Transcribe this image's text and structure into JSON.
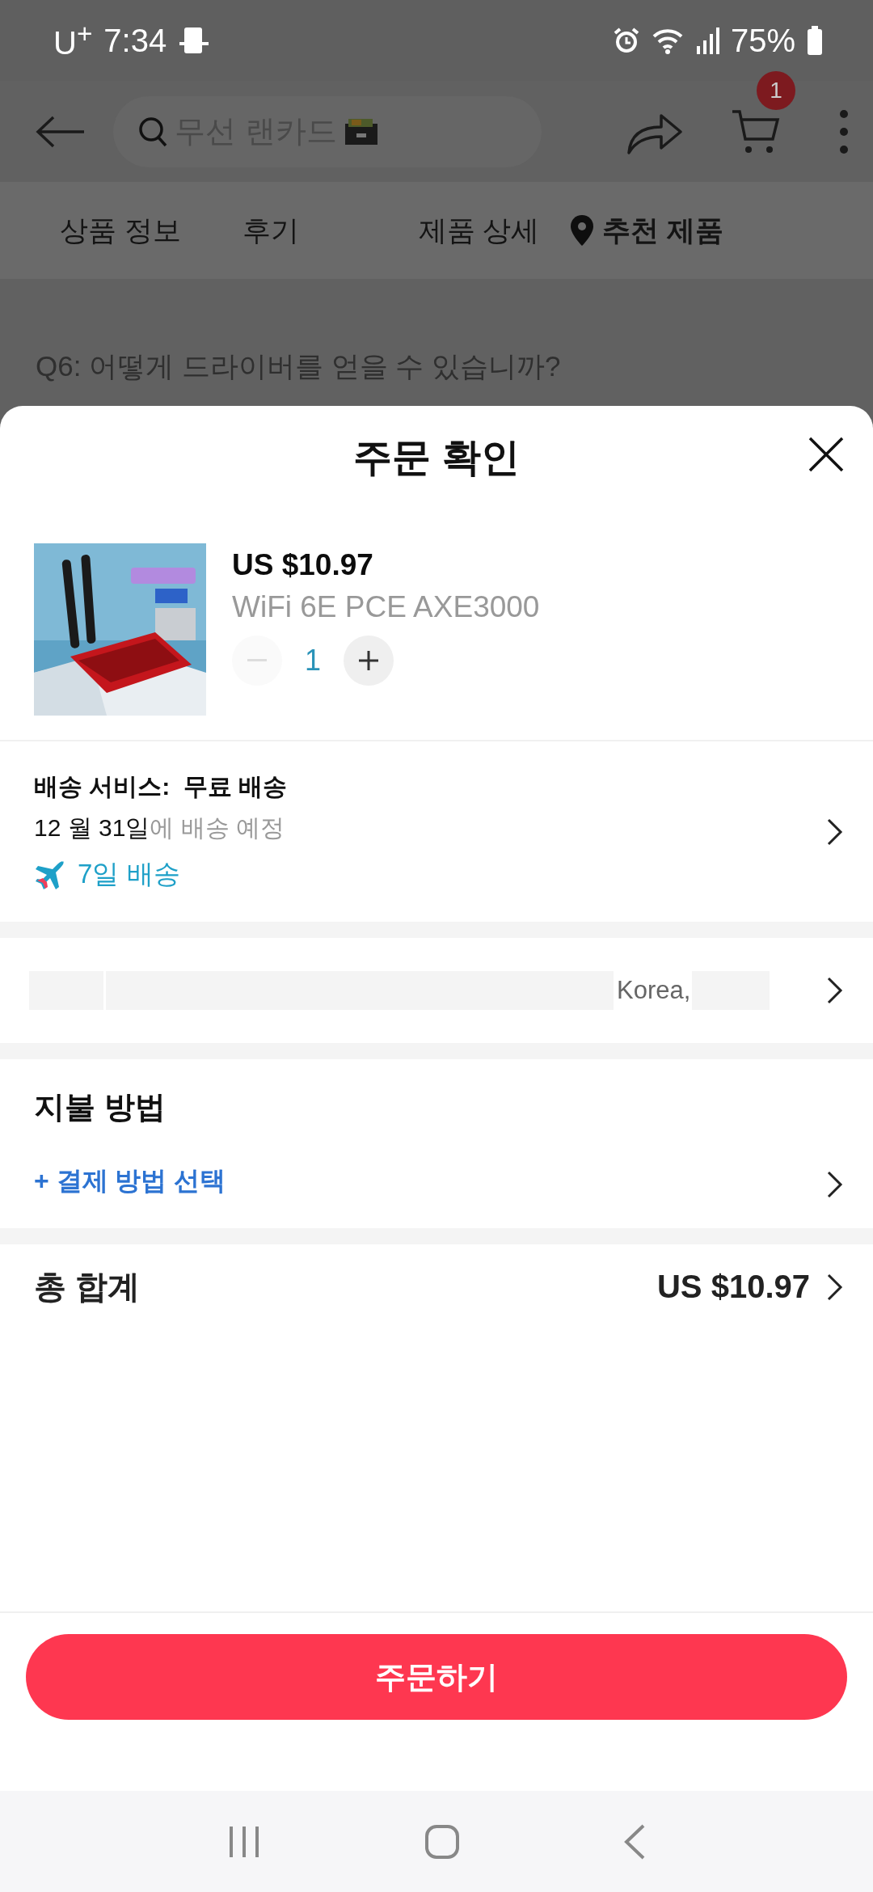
{
  "status_bar": {
    "carrier": "U$^{+}$",
    "time": "7:34",
    "battery": "75%"
  },
  "header": {
    "search": {
      "placeholder": "무선 랜카드"
    },
    "cart_badge": "1"
  },
  "tabs": [
    {
      "label": "상품 정보",
      "selected": false
    },
    {
      "label": "후기",
      "selected": false
    },
    {
      "label": "제품 상세",
      "selected": false
    },
    {
      "label": "추천 제품",
      "selected": true
    }
  ],
  "background_text": "Q6: 어떻게 드라이버를 얻을 수 있습니까?",
  "sheet": {
    "title": "주문 확인",
    "product": {
      "price": "US $10.97",
      "name": "WiFi 6E PCE AXE3000",
      "quantity": "1",
      "decrease_disabled": true
    },
    "shipping": {
      "service": "배송 서비스:  무료 배송",
      "date": "12 월 31일",
      "date_suffix": "에 배송 예정",
      "badge": "7일 배송"
    },
    "address": {
      "text": "Korea,"
    },
    "payment": {
      "title": "지불 방법",
      "action": "+ 결제 방법 선택"
    },
    "total": {
      "label": "총 합계",
      "value": "US $10.97"
    },
    "order_button": "주문하기"
  }
}
